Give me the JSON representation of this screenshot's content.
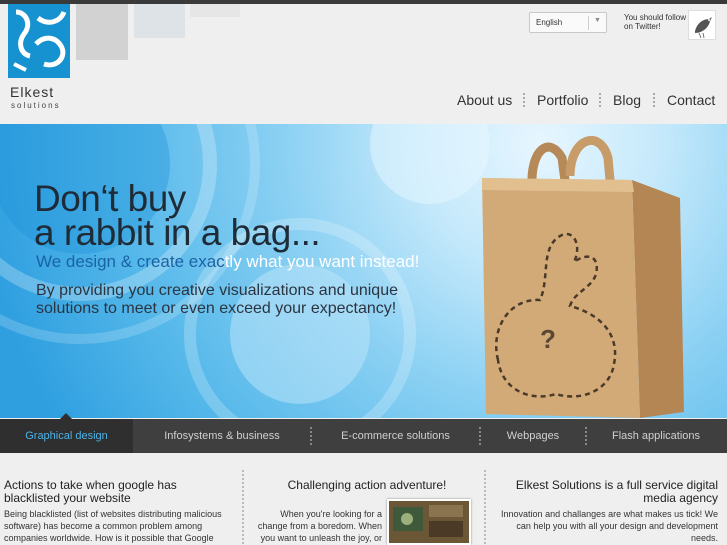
{
  "header": {
    "logo_name": "Elkest",
    "logo_sub": "solutions",
    "language_selected": "English",
    "twitter_text": "You should follow us on Twitter!"
  },
  "nav": {
    "items": [
      {
        "label": "About us"
      },
      {
        "label": "Portfolio"
      },
      {
        "label": "Blog"
      },
      {
        "label": "Contact"
      }
    ]
  },
  "hero": {
    "headline_line1": "Don‘t buy",
    "headline_line2": "a rabbit in a bag...",
    "subline_start": "We design & create exac",
    "subline_highlight": "tly what you want instead!",
    "desc_line1": "By providing you creative visualizations and unique",
    "desc_line2": "solutions to meet or even exceed your expectancy!",
    "bag_mark": "?"
  },
  "tabs": [
    {
      "label": "Graphical design",
      "active": true
    },
    {
      "label": "Infosystems & business"
    },
    {
      "label": "E-commerce solutions"
    },
    {
      "label": "Webpages"
    },
    {
      "label": "Flash applications"
    }
  ],
  "columns": {
    "left": {
      "title": "Actions to take when google has blacklisted your website",
      "text": "Being blacklisted (list of websites distributing malicious software) has become a common problem among companies worldwide. How is it possible that Google"
    },
    "middle": {
      "title": "Challenging action adventure!",
      "text": "When you're looking for a change from a boredom. When you want to unleash the joy, or"
    },
    "right": {
      "title": "Elkest Solutions is a full service digital media agency",
      "text": "Innovation and challanges are what makes us tick! We can help you with all your design and development needs."
    }
  },
  "colors": {
    "accent": "#4bb3e8",
    "brand_blue": "#1592cf",
    "tab_bar": "#3f3f3f"
  }
}
